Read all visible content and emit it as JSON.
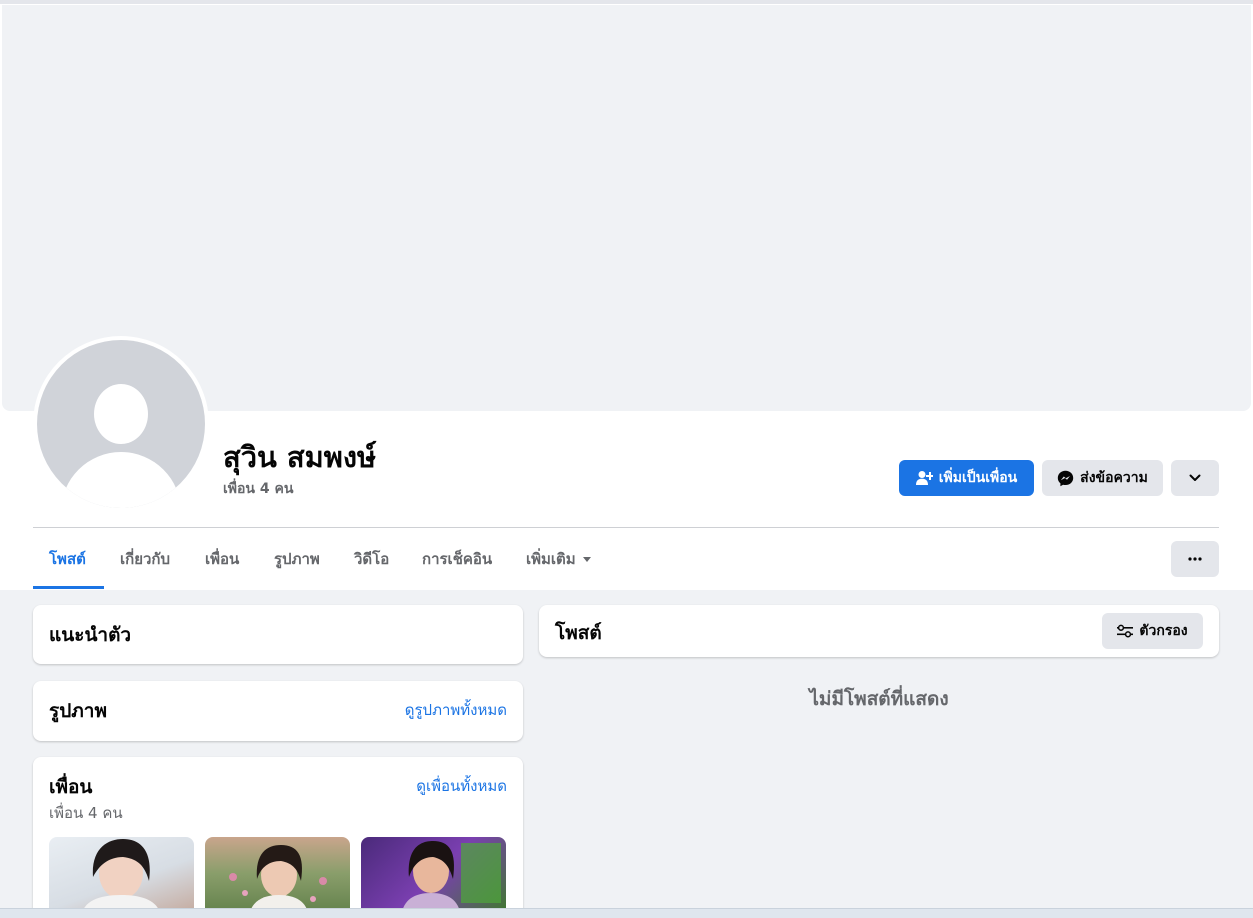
{
  "profile": {
    "name": "สุวิน สมพงษ์",
    "friend_count": "เพื่อน 4 คน"
  },
  "actions": {
    "add_friend_label": "เพิ่มเป็นเพื่อน",
    "message_label": "ส่งข้อความ"
  },
  "tabs": [
    {
      "label": "โพสต์"
    },
    {
      "label": "เกี่ยวกับ"
    },
    {
      "label": "เพื่อน"
    },
    {
      "label": "รูปภาพ"
    },
    {
      "label": "วิดีโอ"
    },
    {
      "label": "การเช็คอิน"
    },
    {
      "label": "เพิ่มเติม"
    }
  ],
  "intro": {
    "title": "แนะนำตัว"
  },
  "photos": {
    "title": "รูปภาพ",
    "link": "ดูรูปภาพทั้งหมด"
  },
  "friends": {
    "title": "เพื่อน",
    "link": "ดูเพื่อนทั้งหมด",
    "count": "เพื่อน 4 คน"
  },
  "posts": {
    "title": "โพสต์",
    "filter_label": "ตัวกรอง",
    "empty": "ไม่มีโพสต์ที่แสดง"
  },
  "colors": {
    "accent": "#1b74e4",
    "page_bg": "#f0f2f5",
    "muted_text": "#65676b"
  },
  "icons": {
    "add_friend": "person-add-icon",
    "messenger": "messenger-icon",
    "more_options": "chevron-down-icon",
    "tab_menu": "more-dots-icon",
    "filter": "filter-sliders-icon"
  }
}
